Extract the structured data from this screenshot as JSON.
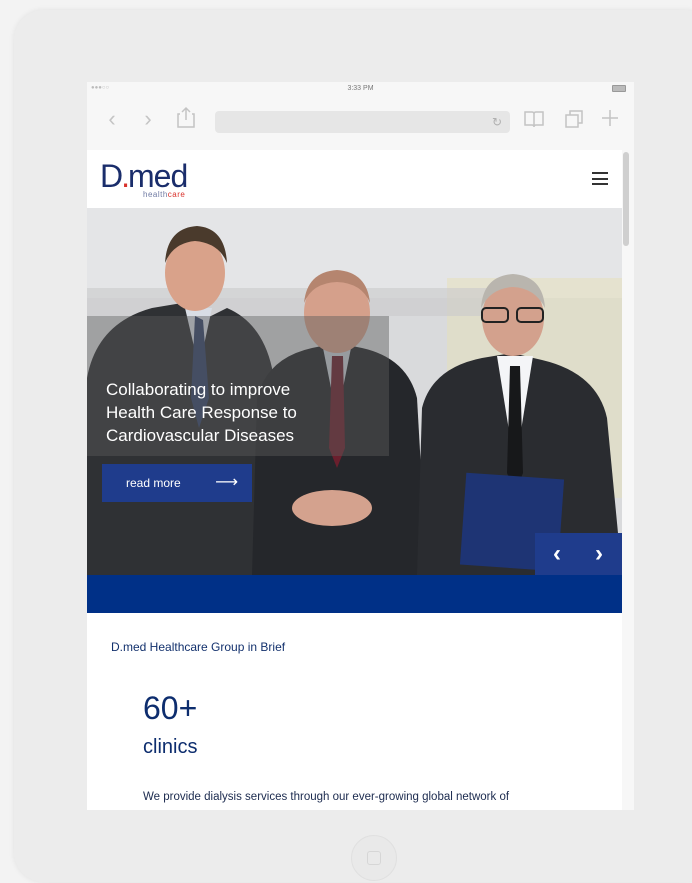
{
  "device": {
    "status_time": "3:33 PM",
    "signal": "●●●○○"
  },
  "browser": {
    "back": "‹",
    "forward": "›",
    "reload": "↻"
  },
  "site": {
    "logo_letter": "D",
    "logo_dot": ".",
    "logo_word": "med",
    "logo_sub_plain": "health",
    "logo_sub_accent": "care"
  },
  "hero": {
    "title": "Collaborating to improve Health Care Response to Cardiovascular Diseases",
    "cta_label": "read more",
    "prev": "‹",
    "next": "›"
  },
  "brief": {
    "title": "D.med Healthcare Group in Brief",
    "stat_number": "60+",
    "stat_label": "clinics",
    "stat_desc": "We provide dialysis services through our ever-growing global network of"
  },
  "colors": {
    "brand_blue": "#1f3c8c",
    "band_blue": "#003087",
    "brand_red": "#d9312b"
  }
}
